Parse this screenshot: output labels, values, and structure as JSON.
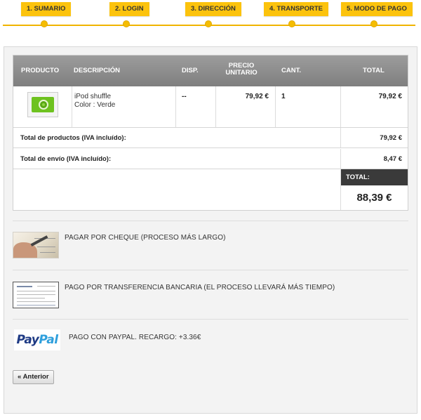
{
  "steps": [
    {
      "label": "1. SUMARIO"
    },
    {
      "label": "2. LOGIN"
    },
    {
      "label": "3. DIRECCIÓN"
    },
    {
      "label": "4. TRANSPORTE"
    },
    {
      "label": "5. MODO DE PAGO"
    }
  ],
  "cart": {
    "headers": {
      "product": "PRODUCTO",
      "description": "DESCRIPCIÓN",
      "availability": "DISP.",
      "unit_price_line1": "PRECIO",
      "unit_price_line2": "UNITARIO",
      "quantity": "CANT.",
      "total": "TOTAL"
    },
    "item": {
      "name": "iPod shuffle",
      "attribute": "Color : Verde",
      "availability": "--",
      "unit_price": "79,92 €",
      "quantity": "1",
      "total": "79,92 €"
    },
    "total_products_label": "Total de productos (IVA incluído):",
    "total_products_value": "79,92 €",
    "total_shipping_label": "Total de envío (IVA incluído):",
    "total_shipping_value": "8,47 €",
    "total_label": "TOTAL:",
    "total_value": "88,39 €"
  },
  "payments": {
    "cheque": "PAGAR POR CHEQUE (PROCESO MÁS LARGO)",
    "transfer": "PAGO POR TRANSFERENCIA BANCARIA (EL PROCESO LLEVARÁ MÁS TIEMPO)",
    "paypal": "PAGO CON PAYPAL. RECARGO: +3.36€",
    "paypal_logo_a": "Pay",
    "paypal_logo_b": "Pal"
  },
  "nav": {
    "previous": "« Anterior"
  },
  "colors": {
    "step_yellow": "#fcc30d",
    "header_gray": "#8c8c8c",
    "total_dark": "#3a3a3a"
  }
}
